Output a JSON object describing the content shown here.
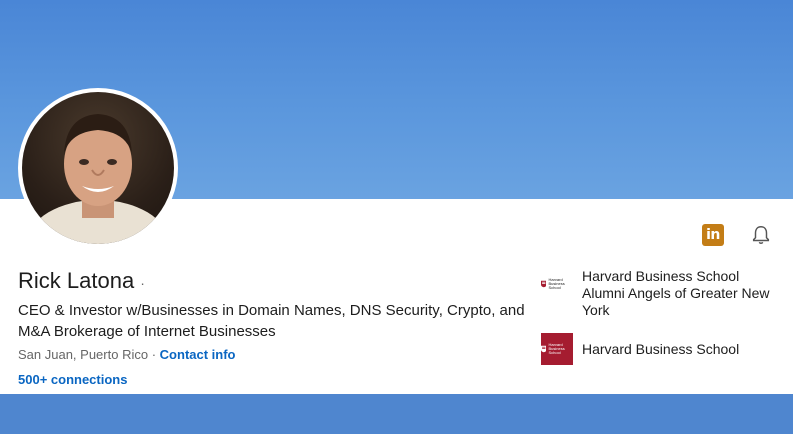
{
  "profile": {
    "name": "Rick Latona",
    "name_suffix": "·",
    "headline": "CEO & Investor w/Businesses in Domain Names, DNS Security, Crypto, and M&A Brokerage of Internet Businesses",
    "location": "San Juan, Puerto Rico",
    "separator": "·",
    "contact_label": "Contact info",
    "connections": "500+ connections"
  },
  "actions": {
    "linkedin_badge": "in",
    "icons": [
      "linkedin-icon",
      "bell-icon"
    ]
  },
  "organizations": [
    {
      "name": "Harvard Business School Alumni Angels of Greater New York",
      "logo_text": "Harvard Business School"
    },
    {
      "name": "Harvard Business School",
      "logo_text": "Harvard Business School"
    }
  ],
  "colors": {
    "cover": "#4a86d6",
    "link": "#0a66c2",
    "badge": "#c37d16",
    "harvard_crimson": "#a51c30"
  }
}
